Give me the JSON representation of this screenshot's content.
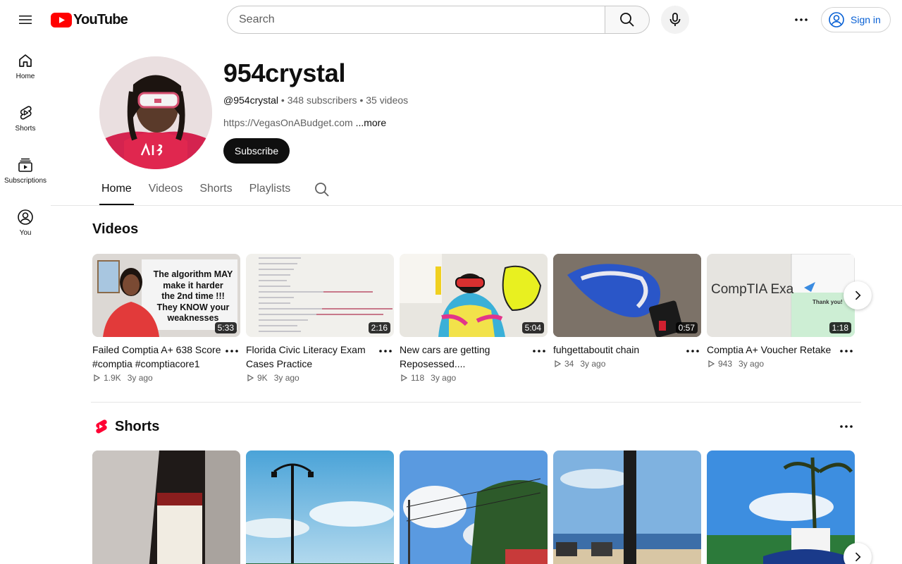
{
  "topbar": {
    "logo_text": "YouTube",
    "search_placeholder": "Search",
    "sign_in_label": "Sign in"
  },
  "guide": {
    "items": [
      {
        "label": "Home",
        "icon": "home-icon"
      },
      {
        "label": "Shorts",
        "icon": "shorts-icon"
      },
      {
        "label": "Subscriptions",
        "icon": "subscriptions-icon"
      },
      {
        "label": "You",
        "icon": "you-icon"
      }
    ]
  },
  "channel": {
    "name": "954crystal",
    "handle": "@954crystal",
    "subscribers": "348 subscribers",
    "videos_count": "35 videos",
    "link": "https://VegasOnABudget.com",
    "more_label": "...more",
    "subscribe_label": "Subscribe"
  },
  "tabs": [
    "Home",
    "Videos",
    "Shorts",
    "Playlists"
  ],
  "videos_section": {
    "title": "Videos",
    "items": [
      {
        "title": "Failed Comptia A+ 638 Score #comptia #comptiacore1",
        "views": "1.9K",
        "age": "3y ago",
        "duration": "5:33",
        "overlay_text": [
          "The algorithm MAY",
          "make it harder",
          "the 2nd time !!!",
          "They KNOW your",
          "weaknesses"
        ]
      },
      {
        "title": "Florida Civic Literacy Exam Cases Practice",
        "views": "9K",
        "age": "3y ago",
        "duration": "2:16"
      },
      {
        "title": "New cars are getting Reposessed....",
        "views": "118",
        "age": "3y ago",
        "duration": "5:04"
      },
      {
        "title": "fuhgettaboutit chain",
        "views": "34",
        "age": "3y ago",
        "duration": "0:57"
      },
      {
        "title": "Comptia A+ Voucher Retake",
        "views": "943",
        "age": "3y ago",
        "duration": "1:18",
        "overlay_text": [
          "CompTIA Exa",
          "Thank you!"
        ]
      }
    ]
  },
  "shorts_section": {
    "title": "Shorts"
  },
  "colors": {
    "brand_red": "#ff0000",
    "link_blue": "#065fd4",
    "text_primary": "#0f0f0f",
    "text_secondary": "#606060"
  }
}
